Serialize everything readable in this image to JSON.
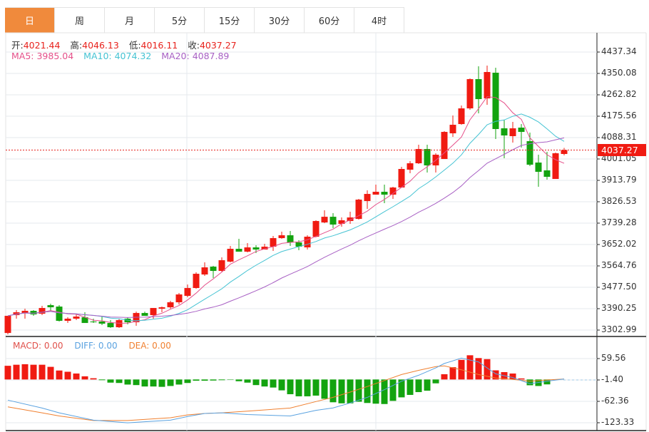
{
  "tabs": [
    {
      "label": "日",
      "active": true
    },
    {
      "label": "周"
    },
    {
      "label": "月"
    },
    {
      "label": "5分"
    },
    {
      "label": "15分"
    },
    {
      "label": "30分"
    },
    {
      "label": "60分"
    },
    {
      "label": "4时"
    }
  ],
  "ohlc_legend": {
    "open_label": "开:",
    "open": "4021.44",
    "high_label": "高:",
    "high": "4046.13",
    "low_label": "低:",
    "low": "4016.11",
    "close_label": "收:",
    "close": "4037.27"
  },
  "ma_legend": {
    "ma5": "MA5: 3985.04",
    "ma10": "MA10: 4074.32",
    "ma20": "MA20: 4087.89"
  },
  "macd_legend": {
    "macd": "MACD: 0.00",
    "diff": "DIFF: 0.00",
    "dea": "DEA: 0.00"
  },
  "current_price": "4037.27",
  "colors": {
    "up": "#f01b12",
    "down": "#13a30f",
    "ma5": "#e5508a",
    "ma10": "#45c3d3",
    "ma20": "#a860c4",
    "diff": "#5aa2e0",
    "dea": "#f08030",
    "tab_active": "#f08a3c"
  },
  "chart_data": {
    "type": "candlestick",
    "price_axis": {
      "ticks": [
        "4437.34",
        "4350.08",
        "4262.82",
        "4175.56",
        "4088.31",
        "4001.05",
        "3913.79",
        "3826.53",
        "3739.28",
        "3652.02",
        "3564.76",
        "3477.50",
        "3390.25",
        "3302.99"
      ],
      "range": [
        3302.99,
        4437.34
      ]
    },
    "candles": [
      [
        3291.1,
        3361.0,
        3285.3,
        3361.0
      ],
      [
        3363.9,
        3384.3,
        3349.4,
        3375.5
      ],
      [
        3372.6,
        3390.1,
        3349.4,
        3381.4
      ],
      [
        3381.4,
        3384.3,
        3361.0,
        3366.8
      ],
      [
        3369.7,
        3401.7,
        3363.9,
        3393.0
      ],
      [
        3404.6,
        3410.5,
        3378.4,
        3395.9
      ],
      [
        3398.8,
        3404.6,
        3337.7,
        3340.6
      ],
      [
        3340.6,
        3355.2,
        3331.9,
        3349.4
      ],
      [
        3349.4,
        3369.7,
        3343.5,
        3358.1
      ],
      [
        3355.2,
        3375.5,
        3331.9,
        3331.9
      ],
      [
        3337.7,
        3349.4,
        3331.9,
        3334.8
      ],
      [
        3337.7,
        3358.1,
        3323.2,
        3329.0
      ],
      [
        3331.9,
        3343.5,
        3311.6,
        3314.5
      ],
      [
        3314.5,
        3349.4,
        3311.6,
        3343.5
      ],
      [
        3349.4,
        3355.2,
        3326.1,
        3334.8
      ],
      [
        3334.8,
        3378.4,
        3320.3,
        3372.6
      ],
      [
        3372.6,
        3378.4,
        3361.0,
        3361.0
      ],
      [
        3363.9,
        3393.0,
        3349.4,
        3393.0
      ],
      [
        3390.1,
        3398.8,
        3375.5,
        3395.9
      ],
      [
        3395.9,
        3422.1,
        3390.1,
        3416.3
      ],
      [
        3416.3,
        3454.1,
        3407.6,
        3448.3
      ],
      [
        3442.5,
        3488.9,
        3436.7,
        3474.5
      ],
      [
        3474.5,
        3538.5,
        3471.6,
        3532.6
      ],
      [
        3529.7,
        3579.2,
        3523.9,
        3558.8
      ],
      [
        3561.7,
        3564.7,
        3515.2,
        3544.3
      ],
      [
        3544.3,
        3599.6,
        3541.4,
        3587.9
      ],
      [
        3582.1,
        3646.1,
        3579.2,
        3634.5
      ],
      [
        3634.5,
        3675.2,
        3622.8,
        3622.8
      ],
      [
        3622.8,
        3657.7,
        3619.9,
        3640.3
      ],
      [
        3640.3,
        3649.0,
        3617.0,
        3631.6
      ],
      [
        3631.6,
        3654.8,
        3631.6,
        3643.2
      ],
      [
        3643.2,
        3686.8,
        3625.7,
        3678.1
      ],
      [
        3678.1,
        3704.3,
        3675.2,
        3689.7
      ],
      [
        3689.7,
        3707.3,
        3646.1,
        3660.6
      ],
      [
        3660.6,
        3669.4,
        3628.6,
        3643.2
      ],
      [
        3640.3,
        3689.7,
        3631.6,
        3683.9
      ],
      [
        3683.9,
        3750.8,
        3681.0,
        3747.9
      ],
      [
        3742.1,
        3791.5,
        3739.2,
        3765.2
      ],
      [
        3765.2,
        3779.9,
        3718.8,
        3733.4
      ],
      [
        3736.3,
        3762.4,
        3724.6,
        3750.8
      ],
      [
        3747.9,
        3785.7,
        3736.3,
        3762.4
      ],
      [
        3756.5,
        3838.1,
        3753.7,
        3835.2
      ],
      [
        3829.4,
        3873.0,
        3797.3,
        3858.4
      ],
      [
        3855.5,
        3896.3,
        3855.5,
        3867.2
      ],
      [
        3867.2,
        3896.3,
        3820.6,
        3855.5
      ],
      [
        3855.5,
        3887.5,
        3838.1,
        3884.6
      ],
      [
        3884.6,
        3969.0,
        3884.6,
        3960.3
      ],
      [
        3957.4,
        3992.3,
        3942.8,
        3983.5
      ],
      [
        3983.5,
        4059.2,
        3980.6,
        4041.7
      ],
      [
        4041.7,
        4059.2,
        3945.7,
        3974.8
      ],
      [
        3974.8,
        4024.3,
        3945.7,
        4018.4
      ],
      [
        4001.0,
        4114.4,
        4001.0,
        4111.5
      ],
      [
        4105.7,
        4178.4,
        4091.2,
        4140.6
      ],
      [
        4143.5,
        4219.2,
        4140.6,
        4207.5
      ],
      [
        4207.5,
        4329.7,
        4201.7,
        4326.8
      ],
      [
        4326.8,
        4379.2,
        4187.2,
        4245.3
      ],
      [
        4248.3,
        4382.1,
        4222.1,
        4355.9
      ],
      [
        4353.0,
        4373.3,
        4082.4,
        4123.2
      ],
      [
        4126.1,
        4161.0,
        4003.9,
        4097.0
      ],
      [
        4094.1,
        4152.2,
        4067.9,
        4126.1
      ],
      [
        4129.0,
        4143.5,
        4047.5,
        4111.5
      ],
      [
        4073.7,
        4108.6,
        3971.9,
        3977.7
      ],
      [
        3986.4,
        4018.4,
        3887.5,
        3948.6
      ],
      [
        3954.5,
        4030.1,
        3916.6,
        3928.3
      ],
      [
        3919.5,
        4027.2,
        3919.5,
        4024.3
      ],
      [
        4021.44,
        4046.13,
        4016.11,
        4037.27
      ]
    ],
    "candle_fields": [
      "open",
      "high",
      "low",
      "close"
    ],
    "macd_axis": {
      "ticks": [
        "59.56",
        "-1.40",
        "-62.36",
        "-123.33"
      ]
    },
    "macd": [
      39,
      42,
      43.5,
      42,
      42,
      36,
      25.5,
      22,
      17,
      9,
      3.5,
      -2,
      -9,
      -10,
      -14.5,
      -16,
      -20,
      -20,
      -21,
      -18.6,
      -14.5,
      -10,
      -3.5,
      -3.5,
      -3,
      -2,
      -1,
      -5,
      -9,
      -16,
      -20,
      -23,
      -31,
      -42,
      -48,
      -48,
      -46,
      -55,
      -65,
      -68,
      -68,
      -63.5,
      -67,
      -69,
      -70,
      -61,
      -51,
      -44,
      -36,
      -32,
      -11,
      15,
      35,
      56,
      69,
      61,
      58,
      26,
      21,
      17,
      3,
      -16.5,
      -18.6,
      -14,
      0,
      0
    ],
    "diff": [
      [
        0,
        -59
      ],
      [
        4,
        -81.5
      ],
      [
        6,
        -95
      ],
      [
        10,
        -116
      ],
      [
        14,
        -123.6
      ],
      [
        19,
        -116
      ],
      [
        21,
        -105.6
      ],
      [
        23,
        -97
      ],
      [
        25,
        -95
      ],
      [
        28,
        -100
      ],
      [
        33,
        -104
      ],
      [
        36,
        -88
      ],
      [
        38,
        -81
      ],
      [
        40,
        -67
      ],
      [
        42,
        -51
      ],
      [
        44,
        -29
      ],
      [
        46,
        -5
      ],
      [
        48,
        12
      ],
      [
        50,
        33
      ],
      [
        51,
        45.5
      ],
      [
        53,
        60.7
      ],
      [
        55,
        50
      ],
      [
        57,
        16
      ],
      [
        59,
        5.5
      ],
      [
        61,
        -12
      ],
      [
        63,
        -5
      ],
      [
        65,
        1.4
      ]
    ],
    "dea": [
      [
        0,
        -78
      ],
      [
        4,
        -95
      ],
      [
        6,
        -104
      ],
      [
        10,
        -117
      ],
      [
        14,
        -117
      ],
      [
        19,
        -109
      ],
      [
        21,
        -101
      ],
      [
        23,
        -97
      ],
      [
        25,
        -95
      ],
      [
        28,
        -90.5
      ],
      [
        33,
        -81.5
      ],
      [
        36,
        -63
      ],
      [
        38,
        -51
      ],
      [
        40,
        -36
      ],
      [
        42,
        -20
      ],
      [
        44,
        -3
      ],
      [
        46,
        14
      ],
      [
        48,
        26
      ],
      [
        50,
        36.6
      ],
      [
        51,
        38.6
      ],
      [
        53,
        27.6
      ],
      [
        55,
        14
      ],
      [
        57,
        4
      ],
      [
        59,
        0
      ],
      [
        61,
        -5
      ],
      [
        63,
        -1.4
      ],
      [
        65,
        1.4
      ]
    ]
  }
}
